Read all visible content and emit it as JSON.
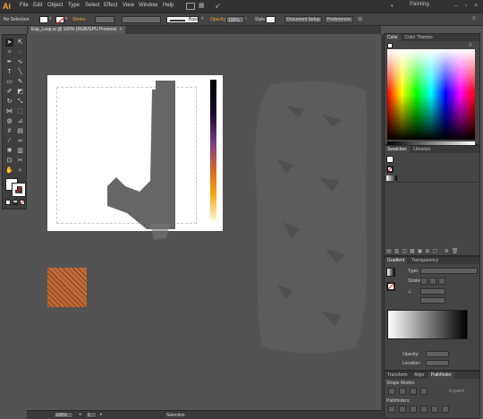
{
  "app": {
    "logo": "Ai",
    "workspace": "Painting"
  },
  "menu": [
    "File",
    "Edit",
    "Object",
    "Type",
    "Select",
    "Effect",
    "View",
    "Window",
    "Help"
  ],
  "control": {
    "selection": "No Selection",
    "stroke_label": "Stroke:",
    "brush": "Basic",
    "opacity_label": "Opacity:",
    "opacity": "100%",
    "style_label": "Style:",
    "doc_setup": "Document Setup",
    "preferences": "Preferences"
  },
  "doc_tab": "Exp_Loop.ai @ 100% (RGB/GPU Preview)",
  "status": {
    "zoom": "100%",
    "page": "1",
    "tool": "Selection"
  },
  "color_panel": {
    "tabs": [
      "Color",
      "Color Themes"
    ]
  },
  "swatches_panel": {
    "tabs": [
      "Swatches",
      "Libraries"
    ]
  },
  "gradient_panel": {
    "tabs": [
      "Gradient",
      "Transparency"
    ],
    "type_label": "Type:",
    "stroke_label": "Stroke:",
    "opacity_label": "Opacity:",
    "location_label": "Location:"
  },
  "pathfinder_panel": {
    "tabs": [
      "Transform",
      "Align",
      "Pathfinder"
    ],
    "shape_modes": "Shape Modes:",
    "pathfinders": "Pathfinders:",
    "expand": "Expand"
  },
  "colors": {
    "accent": "#f0a23a",
    "panel_bg": "#454545",
    "canvas_bg": "#535353"
  }
}
